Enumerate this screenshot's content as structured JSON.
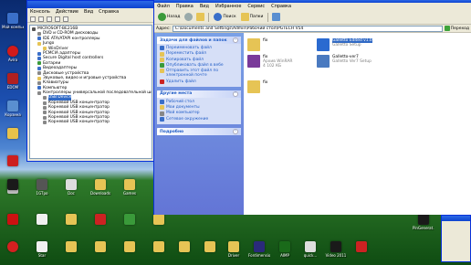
{
  "desktop": {
    "icons_left": [
      {
        "label": "Мой компьютер",
        "color": "#3a6fc9"
      },
      {
        "label": "Avira",
        "color": "#d21a1a"
      },
      {
        "label": "EDOM",
        "color": "#b02020"
      },
      {
        "label": "Корзина",
        "color": "#5a8fd0"
      },
      {
        "label": "",
        "color": "#e8c24a"
      },
      {
        "label": "",
        "color": "#cc1e1e"
      },
      {
        "label": "",
        "color": "#bbbbbb"
      }
    ],
    "icon_rows": [
      {
        "row": 1,
        "items": [
          {
            "label": "",
            "color": "#1a1a1a"
          },
          {
            "label": "1GTpo",
            "color": "#555"
          },
          {
            "label": "Doc",
            "color": "#dddddd"
          },
          {
            "label": "Downloads",
            "color": "#e6c455"
          },
          {
            "label": "Games",
            "color": "#e6c455"
          },
          {
            "label": "",
            "color": "#f1d67a"
          },
          {
            "label": "",
            "color": "#3a8f3a"
          },
          {
            "label": "",
            "color": "#cc3333"
          }
        ]
      },
      {
        "row": 2,
        "items": [
          {
            "label": "",
            "color": "#cc1111"
          },
          {
            "label": "",
            "color": "#f0f0f0"
          },
          {
            "label": "",
            "color": "#e6c455"
          },
          {
            "label": "",
            "color": "#cc2222"
          },
          {
            "label": "",
            "color": "#3a9a3a"
          },
          {
            "label": "",
            "color": "#e6c455"
          },
          {
            "label": "",
            "color": "#2a6ad0"
          },
          {
            "label": "",
            "color": "#dddddd"
          },
          {
            "label": "PinGenerat...",
            "color": "#1a1a1a"
          }
        ]
      },
      {
        "row": 3,
        "items": [
          {
            "label": "",
            "color": "#d42020"
          },
          {
            "label": "Star",
            "color": "#f0f0f0"
          },
          {
            "label": "",
            "color": "#e6c455"
          },
          {
            "label": "",
            "color": "#e6c455"
          },
          {
            "label": "",
            "color": "#e6c455"
          },
          {
            "label": "",
            "color": "#e6c455"
          },
          {
            "label": "",
            "color": "#e6c455"
          },
          {
            "label": "",
            "color": "#e6c455"
          },
          {
            "label": "Driver",
            "color": "#e6c455"
          },
          {
            "label": "Fordimension",
            "color": "#2a2a7a"
          },
          {
            "label": "AIMP",
            "color": "#1a6a1a"
          },
          {
            "label": "quick...",
            "color": "#dddddd"
          },
          {
            "label": "Video 2011",
            "color": "#1a1a1a"
          },
          {
            "label": "",
            "color": "#cc2222"
          }
        ]
      }
    ]
  },
  "device_manager": {
    "menu": [
      "Консоль",
      "Действие",
      "Вид",
      "Справка"
    ],
    "tree": [
      {
        "label": "MICROSOFT-BE216B",
        "level": 0,
        "color": "#555555"
      },
      {
        "label": "DVD и CD-ROM дисководы",
        "level": 1,
        "color": "#888888"
      },
      {
        "label": "IDE ATA/ATAPI контроллеры",
        "level": 1,
        "color": "#3a6fc9"
      },
      {
        "label": "Jungo",
        "level": 1,
        "color": "#e6c455"
      },
      {
        "label": "WinDriver",
        "level": 2,
        "color": "#e6c455"
      },
      {
        "label": "PCMCIA адаптеры",
        "level": 1,
        "color": "#3a6fc9"
      },
      {
        "label": "Secure Digital host controllers",
        "level": 1,
        "color": "#3a6fc9"
      },
      {
        "label": "Батареи",
        "level": 1,
        "color": "#3a9a3a"
      },
      {
        "label": "Видеоадаптеры",
        "level": 1,
        "color": "#3a6fc9"
      },
      {
        "label": "Дисковые устройства",
        "level": 1,
        "color": "#888888"
      },
      {
        "label": "Звуковые, видео и игровые устройства",
        "level": 1,
        "color": "#e6c455"
      },
      {
        "label": "Клавиатуры",
        "level": 1,
        "color": "#888888"
      },
      {
        "label": "Компьютер",
        "level": 1,
        "color": "#3a6fc9"
      },
      {
        "label": "Контроллеры универсальной последовательной шины USB",
        "level": 1,
        "color": "#888888"
      },
      {
        "label": "USB Device",
        "level": 2,
        "color": "#888888",
        "selected": true
      },
      {
        "label": "Корневой USB концентратор",
        "level": 2,
        "color": "#888888"
      },
      {
        "label": "Корневой USB концентратор",
        "level": 2,
        "color": "#888888"
      },
      {
        "label": "Корневой USB концентратор",
        "level": 2,
        "color": "#888888"
      },
      {
        "label": "Корневой USB концентратор",
        "level": 2,
        "color": "#888888"
      },
      {
        "label": "Корневой USB концентратор",
        "level": 2,
        "color": "#888888"
      }
    ]
  },
  "explorer": {
    "menu": [
      "Файл",
      "Правка",
      "Вид",
      "Избранное",
      "Сервис",
      "Справка"
    ],
    "toolbar": {
      "back_label": "Назад",
      "search_label": "Поиск",
      "folders_label": "Папки"
    },
    "address": {
      "label": "Адрес:",
      "path": "C:\\Documents and Settings\\Admin\\Рабочий стол\\PGTECH V54",
      "go_label": "Переход"
    },
    "task_pane": {
      "file_tasks": {
        "title": "Задачи для файлов и папок",
        "items": [
          {
            "label": "Переименовать файл",
            "color": "#3a6fc9"
          },
          {
            "label": "Переместить файл",
            "color": "#e6c455"
          },
          {
            "label": "Копировать файл",
            "color": "#e6c455"
          },
          {
            "label": "Опубликовать файл в вебе",
            "color": "#3a9a3a"
          },
          {
            "label": "Отправить этот файл по электронной почте",
            "color": "#e6c455"
          },
          {
            "label": "Удалить файл",
            "color": "#cc2222"
          }
        ]
      },
      "other_places": {
        "title": "Другие места",
        "items": [
          {
            "label": "Рабочий стол",
            "color": "#3a6fc9"
          },
          {
            "label": "Мои документы",
            "color": "#e6c455"
          },
          {
            "label": "Мой компьютер",
            "color": "#888888"
          },
          {
            "label": "Сетевое окружение",
            "color": "#3a6fc9"
          }
        ]
      },
      "details": {
        "title": "Подробно"
      }
    },
    "files": [
      {
        "name": "fix",
        "sub": "",
        "color": "#e6c455"
      },
      {
        "name": "fix",
        "sub": "Архив WinRAR",
        "sub2": "4 102 КБ",
        "color": "#7a3a9a"
      },
      {
        "name": "fix",
        "sub": "",
        "color": "#e6c455"
      },
      {
        "name": "Galletto Edited v1.0",
        "sub": "Galletto Setup",
        "color": "#2a6ad0",
        "selected": true
      },
      {
        "name": "Galletto-ver7",
        "sub": "Galletto Ver7 Setup",
        "color": "#4a7ac0"
      }
    ]
  }
}
